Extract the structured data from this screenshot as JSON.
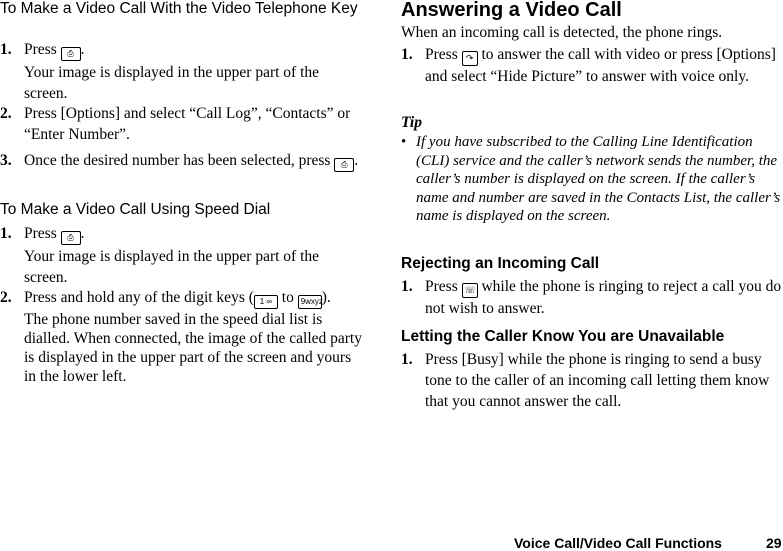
{
  "left": {
    "section1": {
      "heading": "To Make a Video Call With the Video Telephone Key",
      "steps": [
        {
          "num": "1.",
          "text_before": "Press",
          "key": "video-call-key",
          "key_glyph": "⎙",
          "text_after": ".",
          "note": "Your image is displayed in the upper part of the screen."
        },
        {
          "num": "2.",
          "text": "Press [Options] and select “Call Log”, “Contacts” or “Enter Number”."
        },
        {
          "num": "3.",
          "text_before": "Once the desired number has been selected, press",
          "key": "video-call-key",
          "key_glyph": "⎙",
          "text_after": "."
        }
      ]
    },
    "section2": {
      "heading": "To Make a Video Call Using Speed Dial",
      "steps": [
        {
          "num": "1.",
          "text_before": "Press",
          "key": "video-call-key",
          "key_glyph": "⎙",
          "text_after": ".",
          "note": "Your image is displayed in the upper part of the screen."
        },
        {
          "num": "2.",
          "text_before": "Press and hold any of the digit keys (",
          "key_from": "1 ∞",
          "text_mid": " to ",
          "key_to": "9wxyz",
          "text_after": ").",
          "note": "The phone number saved in the speed dial list is dialled. When connected, the image of the called party is displayed in the upper part of the screen and yours in the lower left."
        }
      ]
    }
  },
  "right": {
    "heading": "Answering a Video Call",
    "intro": "When an incoming call is detected, the phone rings.",
    "steps": [
      {
        "num": "1.",
        "text_before": "Press",
        "key": "send-key",
        "key_glyph": "↷",
        "text_after": "to answer the call with video or press [Options] and select “Hide Picture” to answer with voice only."
      }
    ],
    "tip": {
      "label": "Tip",
      "bullet": "•",
      "text": "If you have subscribed to the Calling Line Identification (CLI) service and the caller’s network sends the number, the caller’s number is displayed on the screen. If the caller’s name and number are saved in the Contacts List, the caller’s name is displayed on the screen."
    },
    "rejecting": {
      "heading": "Rejecting an Incoming Call",
      "steps": [
        {
          "num": "1.",
          "text_before": "Press",
          "key": "end-key",
          "key_glyph": "☏",
          "text_after": "while the phone is ringing to reject a call you do not wish to answer."
        }
      ]
    },
    "unavailable": {
      "heading": "Letting the Caller Know You are Unavailable",
      "steps": [
        {
          "num": "1.",
          "text": "Press [Busy] while the phone is ringing to send a busy tone to the caller of an incoming call letting them know that you cannot answer the call."
        }
      ]
    }
  },
  "footer": {
    "section_title": "Voice Call/Video Call Functions",
    "page_number": "29"
  }
}
